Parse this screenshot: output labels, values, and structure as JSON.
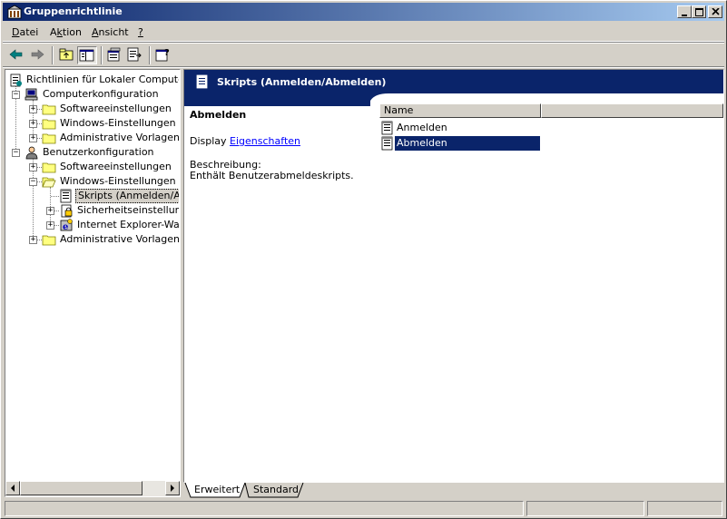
{
  "window": {
    "title": "Gruppenrichtlinie"
  },
  "menu": [
    {
      "label": "Datei",
      "accel": "D"
    },
    {
      "label": "Aktion",
      "accel": "k"
    },
    {
      "label": "Ansicht",
      "accel": "A"
    },
    {
      "label": "?",
      "accel": "?"
    }
  ],
  "toolbar": [
    "back-icon",
    "forward-icon",
    "up-folder-icon",
    "show-tree-icon",
    "properties-icon",
    "export-list-icon",
    "help-icon"
  ],
  "tree": {
    "items": [
      {
        "label": "Richtlinien für Lokaler Computer",
        "icon": "policy-icon"
      },
      {
        "label": "Computerkonfiguration",
        "icon": "computer-icon"
      },
      {
        "label": "Softwareeinstellungen",
        "icon": "folder-icon"
      },
      {
        "label": "Windows-Einstellungen",
        "icon": "folder-icon"
      },
      {
        "label": "Administrative Vorlagen",
        "icon": "folder-icon"
      },
      {
        "label": "Benutzerkonfiguration",
        "icon": "user-icon"
      },
      {
        "label": "Softwareeinstellungen",
        "icon": "folder-icon"
      },
      {
        "label": "Windows-Einstellungen",
        "icon": "folder-open-icon"
      },
      {
        "label": "Skripts (Anmelden/Abmelden)",
        "icon": "script-icon"
      },
      {
        "label": "Sicherheitseinstellungen",
        "icon": "security-icon"
      },
      {
        "label": "Internet Explorer-Wartung",
        "icon": "ie-icon"
      },
      {
        "label": "Administrative Vorlagen",
        "icon": "folder-icon"
      }
    ]
  },
  "details": {
    "banner_title": "Skripts (Anmelden/Abmelden)",
    "heading": "Abmelden",
    "display_prefix": "Display",
    "display_link": "Eigenschaften",
    "description_label": "Beschreibung:",
    "description_text": "Enthält Benutzerabmeldeskripts.",
    "list_header": "Name",
    "list_items": [
      {
        "label": "Anmelden",
        "selected": false
      },
      {
        "label": "Abmelden",
        "selected": true
      }
    ]
  },
  "tabs": [
    {
      "label": "Erweitert",
      "active": true
    },
    {
      "label": "Standard",
      "active": false
    }
  ],
  "colors": {
    "titlebar": "#0a246a",
    "face": "#d4d0c8",
    "selection": "#0a246a",
    "link": "#0000ff"
  }
}
